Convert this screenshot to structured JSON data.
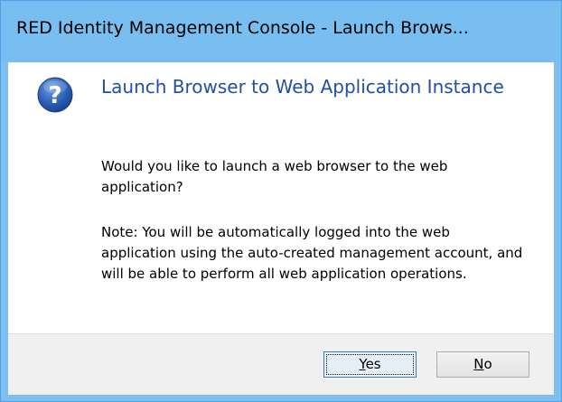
{
  "window": {
    "title": "RED Identity Management Console - Launch Brows..."
  },
  "dialog": {
    "icon": "question-icon",
    "heading": "Launch Browser to Web Application Instance",
    "question": "Would you like to launch a web browser to the web application?",
    "note": "Note: You will be automatically logged into the web application using the auto-created management account, and will be able to perform all web application operations."
  },
  "buttons": {
    "yes": {
      "mnemonic": "Y",
      "rest": "es"
    },
    "no": {
      "mnemonic": "N",
      "rest": "o"
    }
  },
  "colors": {
    "titlebar": "#79bef0",
    "heading": "#1f4fa8",
    "footer": "#f0f0f0"
  }
}
